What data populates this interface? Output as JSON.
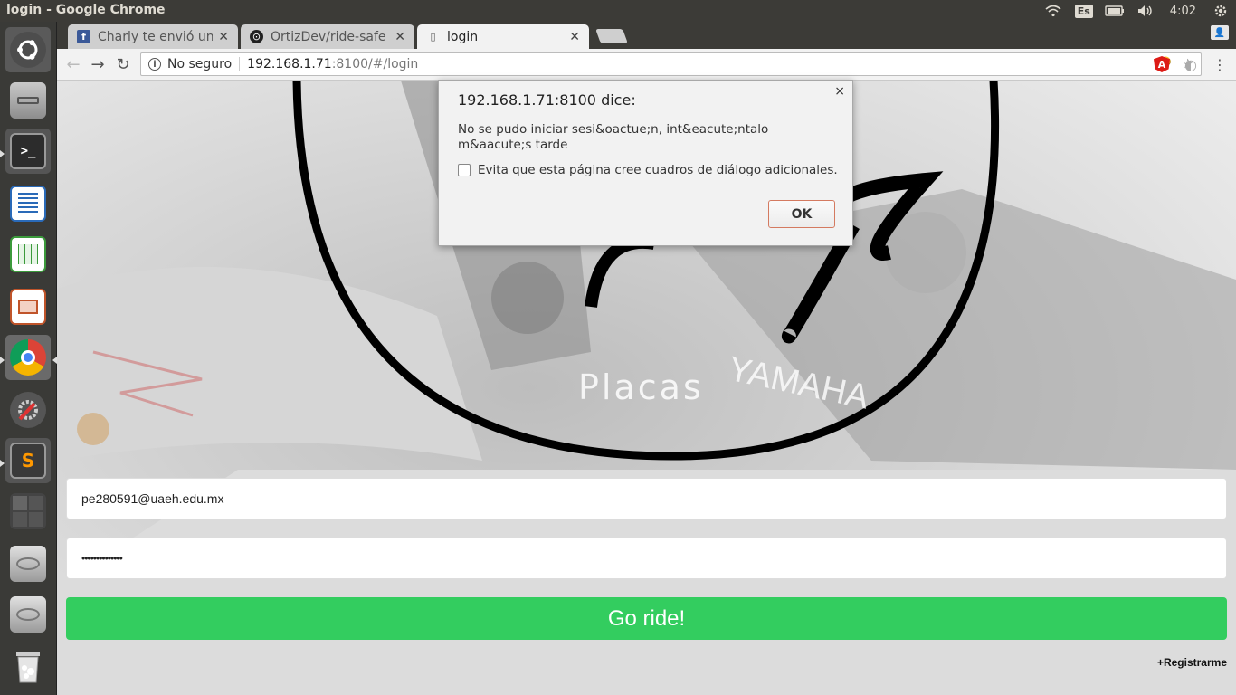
{
  "window": {
    "title": "login - Google Chrome"
  },
  "tray": {
    "keyboard_layout": "Es",
    "time": "4:02"
  },
  "launcher": {
    "items": [
      {
        "name": "ubuntu-dash",
        "color": "#6b6b6b"
      },
      {
        "name": "files",
        "color": "#8a8a8a"
      },
      {
        "name": "terminal",
        "color": "#2c2c2c"
      },
      {
        "name": "libreoffice-writer",
        "color": "#2a6ab8"
      },
      {
        "name": "libreoffice-calc",
        "color": "#3b9a3b"
      },
      {
        "name": "libreoffice-impress",
        "color": "#c0542a"
      },
      {
        "name": "google-chrome",
        "color": "#dd4b39"
      },
      {
        "name": "system-settings",
        "color": "#666"
      },
      {
        "name": "sublime-text",
        "color": "#ff9800"
      },
      {
        "name": "workspace-switcher",
        "color": "#555"
      },
      {
        "name": "drive-1",
        "color": "#999"
      },
      {
        "name": "drive-2",
        "color": "#999"
      },
      {
        "name": "trash",
        "color": "#999"
      }
    ]
  },
  "tabs": [
    {
      "label": "Charly te envió un m",
      "favicon": "f"
    },
    {
      "label": "OrtizDev/ride-safe",
      "favicon": "⊙"
    },
    {
      "label": "login",
      "favicon": "▯"
    }
  ],
  "omnibox": {
    "security": "No seguro",
    "host": "192.168.1.71",
    "path": ":8100/#/login"
  },
  "page": {
    "logo_text": "Placas",
    "email_value": "pe280591@uaeh.edu.mx",
    "password_value": "••••••••••••••",
    "go_button": "Go ride!",
    "register_link": "+Registrarme"
  },
  "dialog": {
    "title": "192.168.1.71:8100 dice:",
    "message": "No se pudo iniciar sesi&oactue;n, int&eacute;ntalo m&aacute;s tarde",
    "checkbox_label": "Evita que esta página cree cuadros de diálogo adicionales.",
    "ok_label": "OK",
    "close_glyph": "×"
  }
}
